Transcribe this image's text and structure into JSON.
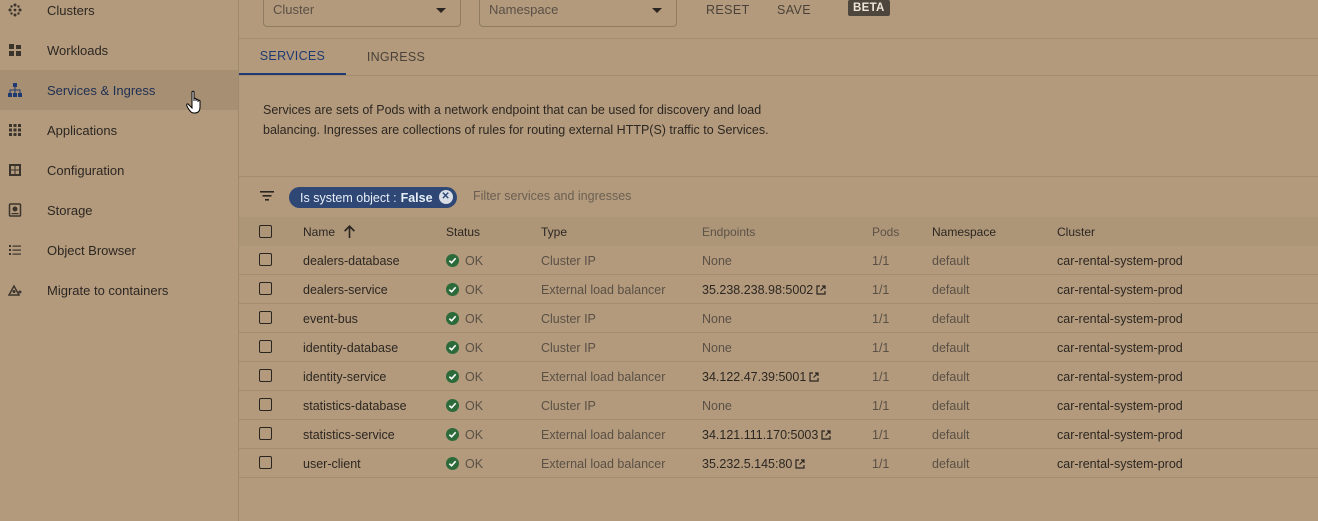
{
  "sidebar": {
    "items": [
      {
        "label": "Clusters",
        "icon": "clusters-icon"
      },
      {
        "label": "Workloads",
        "icon": "workloads-icon"
      },
      {
        "label": "Services & Ingress",
        "icon": "services-icon",
        "active": true
      },
      {
        "label": "Applications",
        "icon": "applications-icon"
      },
      {
        "label": "Configuration",
        "icon": "configuration-icon"
      },
      {
        "label": "Storage",
        "icon": "storage-icon"
      },
      {
        "label": "Object Browser",
        "icon": "object-browser-icon"
      },
      {
        "label": "Migrate to containers",
        "icon": "migrate-icon"
      }
    ]
  },
  "toolbar": {
    "cluster_placeholder": "Cluster",
    "namespace_placeholder": "Namespace",
    "reset_label": "RESET",
    "save_label": "SAVE",
    "beta_label": "BETA"
  },
  "tabs": [
    {
      "label": "SERVICES",
      "active": true
    },
    {
      "label": "INGRESS",
      "active": false
    }
  ],
  "description": "Services are sets of Pods with a network endpoint that can be used for discovery and load balancing. Ingresses are collections of rules for routing external HTTP(S) traffic to Services.",
  "filter": {
    "chip_key": "Is system object :",
    "chip_value": "False",
    "placeholder": "Filter services and ingresses"
  },
  "table": {
    "headers": {
      "name": "Name",
      "status": "Status",
      "type": "Type",
      "endpoints": "Endpoints",
      "pods": "Pods",
      "namespace": "Namespace",
      "cluster": "Cluster"
    },
    "rows": [
      {
        "name": "dealers-database",
        "status": "OK",
        "type": "Cluster IP",
        "endpoints": "None",
        "external": false,
        "pods": "1/1",
        "namespace": "default",
        "cluster": "car-rental-system-prod"
      },
      {
        "name": "dealers-service",
        "status": "OK",
        "type": "External load balancer",
        "endpoints": "35.238.238.98:5002",
        "external": true,
        "pods": "1/1",
        "namespace": "default",
        "cluster": "car-rental-system-prod"
      },
      {
        "name": "event-bus",
        "status": "OK",
        "type": "Cluster IP",
        "endpoints": "None",
        "external": false,
        "pods": "1/1",
        "namespace": "default",
        "cluster": "car-rental-system-prod"
      },
      {
        "name": "identity-database",
        "status": "OK",
        "type": "Cluster IP",
        "endpoints": "None",
        "external": false,
        "pods": "1/1",
        "namespace": "default",
        "cluster": "car-rental-system-prod"
      },
      {
        "name": "identity-service",
        "status": "OK",
        "type": "External load balancer",
        "endpoints": "34.122.47.39:5001",
        "external": true,
        "pods": "1/1",
        "namespace": "default",
        "cluster": "car-rental-system-prod"
      },
      {
        "name": "statistics-database",
        "status": "OK",
        "type": "Cluster IP",
        "endpoints": "None",
        "external": false,
        "pods": "1/1",
        "namespace": "default",
        "cluster": "car-rental-system-prod"
      },
      {
        "name": "statistics-service",
        "status": "OK",
        "type": "External load balancer",
        "endpoints": "34.121.111.170:5003",
        "external": true,
        "pods": "1/1",
        "namespace": "default",
        "cluster": "car-rental-system-prod"
      },
      {
        "name": "user-client",
        "status": "OK",
        "type": "External load balancer",
        "endpoints": "35.232.5.145:80",
        "external": true,
        "pods": "1/1",
        "namespace": "default",
        "cluster": "car-rental-system-prod"
      }
    ]
  },
  "colors": {
    "accent": "#1f3a72",
    "chip": "#2e4775",
    "ok": "#2d6a3a",
    "background": "#b39a7c"
  }
}
